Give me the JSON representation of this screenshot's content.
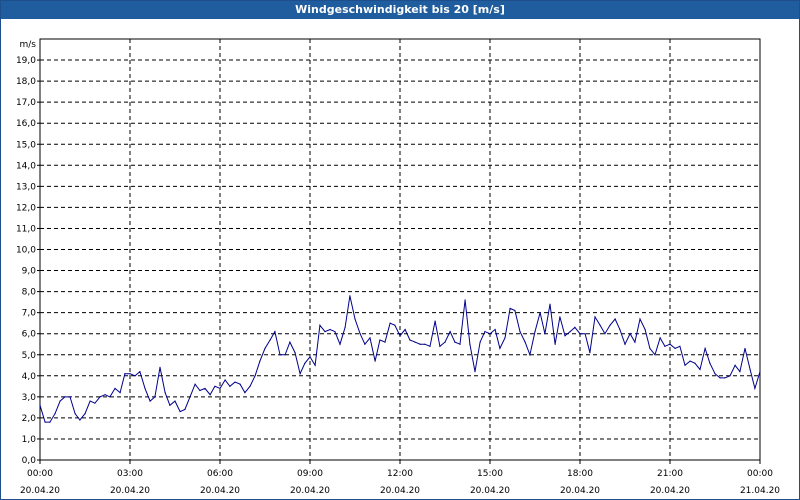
{
  "chart_data": {
    "type": "line",
    "title": "Windgeschwindigkeit bis 20 [m/s]",
    "ylabel": "m/s",
    "ylim": [
      0,
      20
    ],
    "y_ticks": [
      "0,0",
      "1,0",
      "2,0",
      "3,0",
      "4,0",
      "5,0",
      "6,0",
      "7,0",
      "8,0",
      "9,0",
      "10,0",
      "11,0",
      "12,0",
      "13,0",
      "14,0",
      "15,0",
      "16,0",
      "17,0",
      "18,0",
      "19,0"
    ],
    "x_ticks": [
      {
        "time": "00:00",
        "date": "20.04.20"
      },
      {
        "time": "03:00",
        "date": "20.04.20"
      },
      {
        "time": "06:00",
        "date": "20.04.20"
      },
      {
        "time": "09:00",
        "date": "20.04.20"
      },
      {
        "time": "12:00",
        "date": "20.04.20"
      },
      {
        "time": "15:00",
        "date": "20.04.20"
      },
      {
        "time": "18:00",
        "date": "20.04.20"
      },
      {
        "time": "21:00",
        "date": "20.04.20"
      },
      {
        "time": "00:00",
        "date": "21.04.20"
      }
    ],
    "x_range_hours": [
      0,
      24
    ],
    "grid": true,
    "series": [
      {
        "color": "#00008b",
        "values": [
          [
            0.0,
            2.6
          ],
          [
            0.17,
            1.8
          ],
          [
            0.33,
            1.8
          ],
          [
            0.5,
            2.2
          ],
          [
            0.67,
            2.8
          ],
          [
            0.83,
            3.0
          ],
          [
            1.0,
            3.0
          ],
          [
            1.17,
            2.2
          ],
          [
            1.33,
            1.9
          ],
          [
            1.5,
            2.2
          ],
          [
            1.67,
            2.8
          ],
          [
            1.83,
            2.7
          ],
          [
            2.0,
            3.0
          ],
          [
            2.17,
            3.1
          ],
          [
            2.33,
            3.0
          ],
          [
            2.5,
            3.4
          ],
          [
            2.67,
            3.2
          ],
          [
            2.83,
            4.1
          ],
          [
            3.0,
            4.1
          ],
          [
            3.17,
            4.0
          ],
          [
            3.33,
            4.2
          ],
          [
            3.5,
            3.4
          ],
          [
            3.67,
            2.8
          ],
          [
            3.83,
            3.0
          ],
          [
            4.0,
            4.4
          ],
          [
            4.17,
            3.2
          ],
          [
            4.33,
            2.6
          ],
          [
            4.5,
            2.8
          ],
          [
            4.67,
            2.3
          ],
          [
            4.83,
            2.4
          ],
          [
            5.0,
            3.0
          ],
          [
            5.17,
            3.6
          ],
          [
            5.33,
            3.3
          ],
          [
            5.5,
            3.4
          ],
          [
            5.67,
            3.1
          ],
          [
            5.83,
            3.5
          ],
          [
            6.0,
            3.4
          ],
          [
            6.17,
            3.8
          ],
          [
            6.33,
            3.5
          ],
          [
            6.5,
            3.7
          ],
          [
            6.67,
            3.6
          ],
          [
            6.83,
            3.2
          ],
          [
            7.0,
            3.5
          ],
          [
            7.17,
            4.0
          ],
          [
            7.33,
            4.7
          ],
          [
            7.5,
            5.3
          ],
          [
            7.67,
            5.7
          ],
          [
            7.83,
            6.1
          ],
          [
            8.0,
            5.0
          ],
          [
            8.17,
            5.0
          ],
          [
            8.33,
            5.6
          ],
          [
            8.5,
            5.1
          ],
          [
            8.67,
            4.1
          ],
          [
            8.83,
            4.6
          ],
          [
            9.0,
            4.9
          ],
          [
            9.17,
            4.5
          ],
          [
            9.33,
            6.4
          ],
          [
            9.5,
            6.1
          ],
          [
            9.67,
            6.2
          ],
          [
            9.83,
            6.1
          ],
          [
            10.0,
            5.5
          ],
          [
            10.17,
            6.3
          ],
          [
            10.33,
            7.8
          ],
          [
            10.5,
            6.7
          ],
          [
            10.67,
            6.0
          ],
          [
            10.83,
            5.5
          ],
          [
            11.0,
            5.8
          ],
          [
            11.17,
            4.7
          ],
          [
            11.33,
            5.7
          ],
          [
            11.5,
            5.6
          ],
          [
            11.67,
            6.5
          ],
          [
            11.83,
            6.4
          ],
          [
            12.0,
            5.9
          ],
          [
            12.17,
            6.2
          ],
          [
            12.33,
            5.7
          ],
          [
            12.5,
            5.6
          ],
          [
            12.67,
            5.5
          ],
          [
            12.83,
            5.5
          ],
          [
            13.0,
            5.4
          ],
          [
            13.17,
            6.6
          ],
          [
            13.33,
            5.4
          ],
          [
            13.5,
            5.6
          ],
          [
            13.67,
            6.1
          ],
          [
            13.83,
            5.6
          ],
          [
            14.0,
            5.5
          ],
          [
            14.17,
            7.6
          ],
          [
            14.33,
            5.5
          ],
          [
            14.5,
            4.2
          ],
          [
            14.67,
            5.6
          ],
          [
            14.83,
            6.1
          ],
          [
            15.0,
            6.0
          ],
          [
            15.17,
            6.2
          ],
          [
            15.33,
            5.3
          ],
          [
            15.5,
            5.8
          ],
          [
            15.67,
            7.2
          ],
          [
            15.83,
            7.1
          ],
          [
            16.0,
            6.1
          ],
          [
            16.17,
            5.6
          ],
          [
            16.33,
            5.0
          ],
          [
            16.5,
            6.1
          ],
          [
            16.67,
            7.0
          ],
          [
            16.83,
            6.0
          ],
          [
            17.0,
            7.4
          ],
          [
            17.17,
            5.5
          ],
          [
            17.33,
            6.8
          ],
          [
            17.5,
            5.9
          ],
          [
            17.67,
            6.1
          ],
          [
            17.83,
            6.3
          ],
          [
            18.0,
            6.0
          ],
          [
            18.17,
            6.0
          ],
          [
            18.33,
            5.1
          ],
          [
            18.5,
            6.8
          ],
          [
            18.67,
            6.4
          ],
          [
            18.83,
            6.0
          ],
          [
            19.0,
            6.4
          ],
          [
            19.17,
            6.7
          ],
          [
            19.33,
            6.2
          ],
          [
            19.5,
            5.5
          ],
          [
            19.67,
            6.0
          ],
          [
            19.83,
            5.6
          ],
          [
            20.0,
            6.7
          ],
          [
            20.17,
            6.2
          ],
          [
            20.33,
            5.3
          ],
          [
            20.5,
            5.0
          ],
          [
            20.67,
            5.8
          ],
          [
            20.83,
            5.4
          ],
          [
            21.0,
            5.5
          ],
          [
            21.17,
            5.3
          ],
          [
            21.33,
            5.4
          ],
          [
            21.5,
            4.5
          ],
          [
            21.67,
            4.7
          ],
          [
            21.83,
            4.6
          ],
          [
            22.0,
            4.3
          ],
          [
            22.17,
            5.3
          ],
          [
            22.33,
            4.6
          ],
          [
            22.5,
            4.1
          ],
          [
            22.67,
            3.9
          ],
          [
            22.83,
            3.9
          ],
          [
            23.0,
            4.0
          ],
          [
            23.17,
            4.5
          ],
          [
            23.33,
            4.2
          ],
          [
            23.5,
            5.3
          ],
          [
            23.67,
            4.3
          ],
          [
            23.83,
            3.4
          ],
          [
            24.0,
            4.2
          ]
        ]
      }
    ]
  }
}
